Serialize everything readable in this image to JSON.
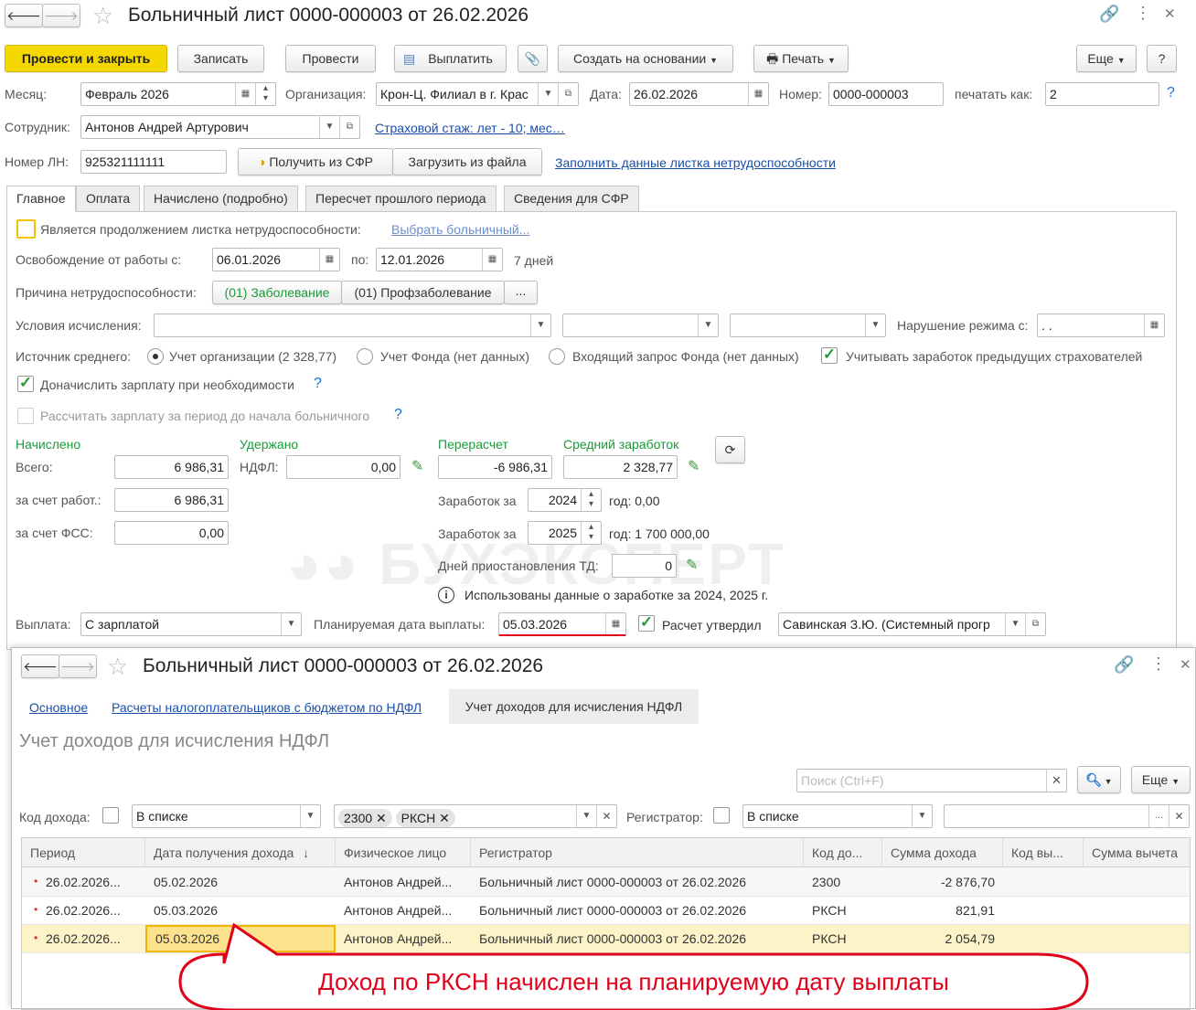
{
  "window1": {
    "title": "Больничный лист 0000-000003 от 26.02.2026",
    "toolbar": {
      "post_close": "Провести и закрыть",
      "save": "Записать",
      "post": "Провести",
      "pay": "Выплатить",
      "create_based": "Создать на основании",
      "print": "Печать",
      "more": "Еще",
      "help": "?"
    },
    "header": {
      "month_label": "Месяц:",
      "month": "Февраль 2026",
      "org_label": "Организация:",
      "org": "Крон-Ц. Филиал в г. Крас",
      "date_label": "Дата:",
      "date": "26.02.2026",
      "number_label": "Номер:",
      "number": "0000-000003",
      "print_as_label": "печатать как:",
      "print_as": "2",
      "help": "?",
      "employee_label": "Сотрудник:",
      "employee": "Антонов Андрей Артурович",
      "insurance_link": "Страховой стаж: лет - 10; мес…",
      "ln_label": "Номер ЛН:",
      "ln": "925321111111",
      "get_sfr": "Получить из СФР",
      "load_file": "Загрузить из файла",
      "fill_link": "Заполнить данные листка нетрудоспособности"
    },
    "tabs": [
      "Главное",
      "Оплата",
      "Начислено (подробно)",
      "Пересчет прошлого периода",
      "Сведения для СФР"
    ],
    "main": {
      "continuation_label": "Является продолжением листка нетрудоспособности:",
      "choose_link": "Выбрать больничный...",
      "release_label": "Освобождение от работы с:",
      "release_from": "06.01.2026",
      "to_label": "по:",
      "release_to": "12.01.2026",
      "days": "7 дней",
      "reason_label": "Причина нетрудоспособности:",
      "reason1": "(01) Заболевание",
      "reason2": "(01) Профзаболевание",
      "reason_more": "...",
      "conditions_label": "Условия исчисления:",
      "violation_label": "Нарушение режима с:",
      "violation": " .  .",
      "avg_source_label": "Источник среднего:",
      "src1": "Учет организации (2 328,77)",
      "src2": "Учет Фонда (нет данных)",
      "src3": "Входящий запрос Фонда (нет данных)",
      "prev_employers": "Учитывать заработок предыдущих страхователей",
      "extra_pay": "Доначислить зарплату при необходимости",
      "calc_before": "Рассчитать зарплату за период до начала больничного",
      "help": "?",
      "accrued_h": "Начислено",
      "withheld_h": "Удержано",
      "recalc_h": "Перерасчет",
      "avg_h": "Средний заработок",
      "total_label": "Всего:",
      "total": "6 986,31",
      "ndfl_label": "НДФЛ:",
      "ndfl": "0,00",
      "recalc": "-6 986,31",
      "avg": "2 328,77",
      "employer_label": "за счет работ.:",
      "employer": "6 986,31",
      "fss_label": "за счет ФСС:",
      "fss": "0,00",
      "earn_label": "Заработок за",
      "year1": "2024",
      "year1_text": "год: 0,00",
      "year2": "2025",
      "year2_text": "год: 1 700 000,00",
      "suspend_label": "Дней приостановления ТД:",
      "suspend": "0",
      "used_info": "Использованы данные о заработке за  2024,  2025 г.",
      "payout_label": "Выплата:",
      "payout": "С зарплатой",
      "plan_date_label": "Планируемая дата выплаты:",
      "plan_date": "05.03.2026",
      "approved_label": "Расчет утвердил",
      "approved": "Савинская З.Ю. (Системный прогр"
    },
    "watermark": "БУХЭКСПЕРТ"
  },
  "window2": {
    "title": "Больничный лист 0000-000003 от 26.02.2026",
    "nav": [
      "Основное",
      "Расчеты налогоплательщиков с бюджетом по НДФЛ",
      "Учет доходов для исчисления НДФЛ"
    ],
    "heading": "Учет доходов для исчисления НДФЛ",
    "search_placeholder": "Поиск (Ctrl+F)",
    "more": "Еще",
    "filter": {
      "code_label": "Код дохода:",
      "code_mode": "В списке",
      "tags": [
        "2300",
        "РКСН"
      ],
      "reg_label": "Регистратор:",
      "reg_mode": "В списке",
      "reg_value": ""
    },
    "columns": [
      "Период",
      "Дата получения дохода",
      "Физическое лицо",
      "Регистратор",
      "Код до...",
      "Сумма дохода",
      "Код вы...",
      "Сумма вычета"
    ],
    "rows": [
      [
        "26.02.2026...",
        "05.02.2026",
        "Антонов Андрей...",
        "Больничный лист 0000-000003 от 26.02.2026",
        "2300",
        "-2 876,70",
        "",
        ""
      ],
      [
        "26.02.2026...",
        "05.03.2026",
        "Антонов Андрей...",
        "Больничный лист 0000-000003 от 26.02.2026",
        "РКСН",
        "821,91",
        "",
        ""
      ],
      [
        "26.02.2026...",
        "05.03.2026",
        "Антонов Андрей...",
        "Больничный лист 0000-000003 от 26.02.2026",
        "РКСН",
        "2 054,79",
        "",
        ""
      ]
    ]
  },
  "callout": "Доход по РКСН начислен на планируемую дату выплаты",
  "colors": {
    "accent": "#f5d800",
    "link": "#1a4fa8",
    "green": "#1a9a3a",
    "callout": "#e0001a",
    "selected_row": "#fdf3c8"
  }
}
